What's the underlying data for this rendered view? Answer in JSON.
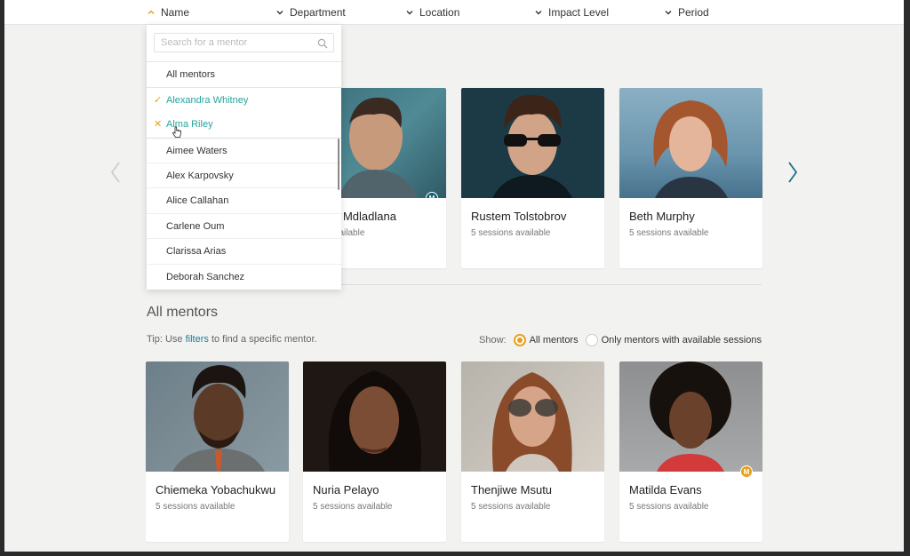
{
  "filters": [
    {
      "label": "Name",
      "open": true
    },
    {
      "label": "Department",
      "open": false
    },
    {
      "label": "Location",
      "open": false
    },
    {
      "label": "Impact Level",
      "open": false
    },
    {
      "label": "Period",
      "open": false
    }
  ],
  "dropdown": {
    "search_placeholder": "Search for a mentor",
    "search_value": "",
    "all_label": "All mentors",
    "selected": [
      {
        "label": "Alexandra Whitney",
        "mark": "✓"
      },
      {
        "label": "Alma Riley",
        "mark": "✕"
      }
    ],
    "options": [
      "Aimee Waters",
      "Alex Karpovsky",
      "Alice Callahan",
      "Carlene Oum",
      "Clarissa Arias",
      "Deborah Sanchez"
    ]
  },
  "featured": [
    {
      "name": "Nkosi Mdladlana",
      "visible_name": "nkosi Mdladlana",
      "sessions": "5 sessions available",
      "visible_sessions": "ons available",
      "badge": "M",
      "badge_color": "#0b5f78"
    },
    {
      "name": "Rustem Tolstobrov",
      "sessions": "5 sessions available"
    },
    {
      "name": "Beth Murphy",
      "sessions": "5 sessions available"
    }
  ],
  "section": {
    "title": "All mentors",
    "tip_prefix": "Tip: Use ",
    "tip_link": "filters",
    "tip_suffix": " to find a specific mentor.",
    "show_label": "Show:",
    "show_options": [
      {
        "label": "All mentors",
        "selected": true
      },
      {
        "label": "Only mentors with available sessions",
        "selected": false
      }
    ]
  },
  "mentors": [
    {
      "name": "Chiemeka Yobachukwu",
      "sessions": "5 sessions available"
    },
    {
      "name": "Nuria Pelayo",
      "sessions": "5 sessions available"
    },
    {
      "name": "Thenjiwe Msutu",
      "sessions": "5 sessions available"
    },
    {
      "name": "Matilda Evans",
      "sessions": "5 sessions available",
      "badge": "M",
      "badge_color": "#e6a01d"
    }
  ],
  "colors": {
    "accent_teal": "#23a59a",
    "accent_orange": "#e6a01d",
    "link": "#1a7f9a",
    "arrow": "#1a6f8a"
  },
  "icons": [
    "chevron-up-icon",
    "chevron-down-icon",
    "search-icon",
    "check-icon",
    "close-icon",
    "chevron-left-icon",
    "chevron-right-icon",
    "hand-cursor-icon"
  ]
}
